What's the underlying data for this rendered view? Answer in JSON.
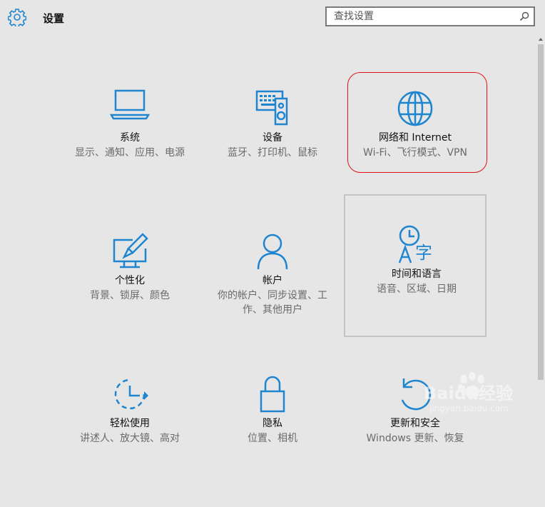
{
  "header": {
    "title": "设置",
    "icon": "gear-icon",
    "search_placeholder": "查找设置"
  },
  "tiles": [
    {
      "id": "system",
      "icon": "laptop-icon",
      "name": "系统",
      "desc": "显示、通知、应用、电源"
    },
    {
      "id": "devices",
      "icon": "devices-icon",
      "name": "设备",
      "desc": "蓝牙、打印机、鼠标"
    },
    {
      "id": "network",
      "icon": "globe-icon",
      "name": "网络和 Internet",
      "desc": "Wi-Fi、飞行模式、VPN"
    },
    {
      "id": "personalization",
      "icon": "paintbrush-icon",
      "name": "个性化",
      "desc": "背景、锁屏、颜色"
    },
    {
      "id": "accounts",
      "icon": "person-icon",
      "name": "帐户",
      "desc": "你的帐户、同步设置、工作、其他用户"
    },
    {
      "id": "time-language",
      "icon": "clock-language-icon",
      "name": "时间和语言",
      "desc": "语音、区域、日期"
    },
    {
      "id": "ease-of-access",
      "icon": "ease-of-access-icon",
      "name": "轻松使用",
      "desc": "讲述人、放大镜、高对"
    },
    {
      "id": "privacy",
      "icon": "lock-icon",
      "name": "隐私",
      "desc": "位置、相机"
    },
    {
      "id": "update-security",
      "icon": "refresh-icon",
      "name": "更新和安全",
      "desc": "Windows 更新、恢复"
    }
  ],
  "selected_tile": "time-language",
  "highlighted_tile": "network",
  "watermark": {
    "logo": "Baidu经验",
    "url": "jingyan.baidu.com"
  },
  "colors": {
    "accent": "#1e85d0",
    "background": "#e6e6e6",
    "highlight": "#e01414"
  }
}
